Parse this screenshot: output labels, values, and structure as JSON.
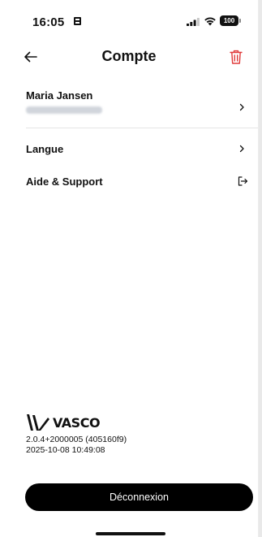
{
  "status_bar": {
    "time": "16:05",
    "battery": "100",
    "icons": [
      "sim-icon",
      "signal-icon",
      "wifi-icon",
      "battery-icon"
    ]
  },
  "header": {
    "title": "Compte",
    "back_icon": "arrow-left-icon",
    "delete_icon": "trash-icon"
  },
  "account": {
    "name": "Maria Jansen"
  },
  "menu": {
    "language_label": "Langue",
    "support_label": "Aide & Support"
  },
  "app_info": {
    "logo_text": "VASCO",
    "version": "2.0.4+2000005 (405160f9)",
    "build_date": "2025-10-08 10:49:08"
  },
  "logout_label": "Déconnexion",
  "colors": {
    "accent_red": "#e03a3a",
    "button_bg": "#000000"
  }
}
